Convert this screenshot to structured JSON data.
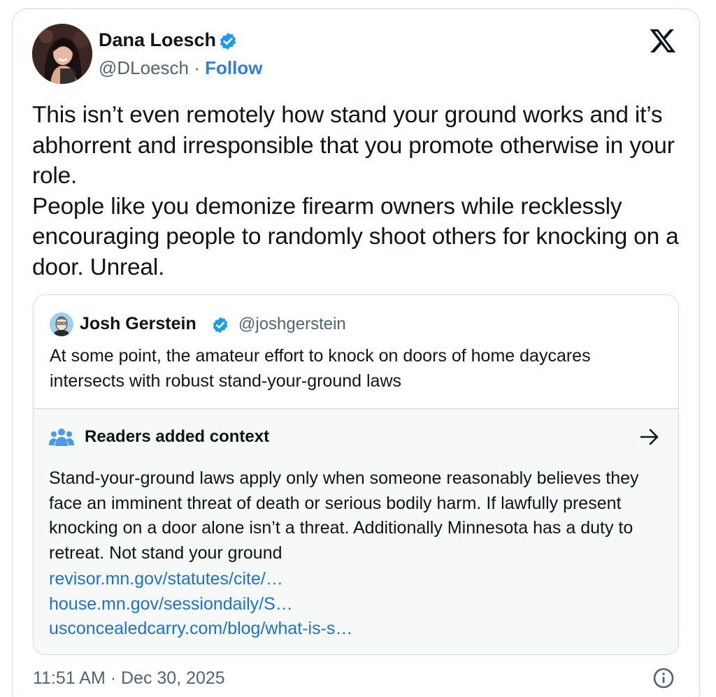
{
  "tweet": {
    "author": {
      "name": "Dana Loesch",
      "handle": "@DLoesch",
      "separator": " · ",
      "follow_label": "Follow",
      "avatar_icon": "profile-photo",
      "verified_icon": "verified-badge-icon"
    },
    "platform_icon": "x-logo-icon",
    "text_lines": [
      "This isn’t even remotely how stand your ground works and it’s abhorrent and irresponsible that you promote otherwise in your role.",
      "People like you demonize firearm owners while recklessly encouraging people to randomly shoot others for knocking on a door. Unreal."
    ],
    "quoted_tweet": {
      "name": "Josh Gerstein",
      "handle": "@joshgerstein",
      "text": "At some point, the amateur effort to knock on doors of home daycares intersects with robust stand-your-ground laws"
    },
    "community_note": {
      "title": "Readers added context",
      "icon": "people-group-icon",
      "body": "Stand-your-ground laws apply only when someone reasonably believes they face an imminent threat of death or serious bodily harm. If lawfully present knocking on a door alone isn’t a threat. Additionally Minnesota has a duty to retreat. Not stand your ground",
      "links": [
        "revisor.mn.gov/statutes/cite/…",
        "house.mn.gov/sessiondaily/S…",
        "usconcealedcarry.com/blog/what-is-s…"
      ]
    },
    "timestamp": "11:51 AM · Dec 30, 2025"
  },
  "colors": {
    "text": "#0f1419",
    "secondary": "#536471",
    "link": "#1d9bf0",
    "verified": "#1d9bf0",
    "border": "#cfd9de",
    "note_bg": "#f7f9f9"
  }
}
